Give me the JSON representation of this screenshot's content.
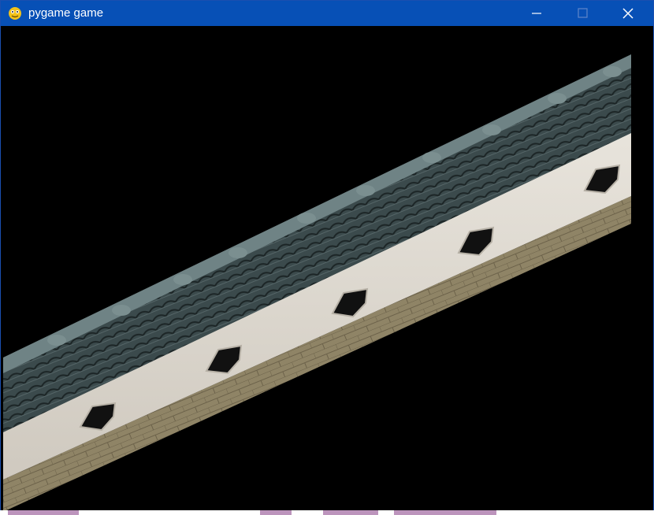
{
  "window": {
    "title": "pygame game",
    "app_icon": "pygame-snake-icon",
    "controls": [
      "minimize-icon",
      "maximize-icon",
      "close-icon"
    ],
    "accent_color": "#0750b6"
  },
  "scene": {
    "description_icon": "tiled-roof-wall-sprite",
    "background_color": "#000000",
    "wall_color": "#ddd9d2",
    "roof_color": "#3b4a4c",
    "base_color": "#8f8466"
  }
}
